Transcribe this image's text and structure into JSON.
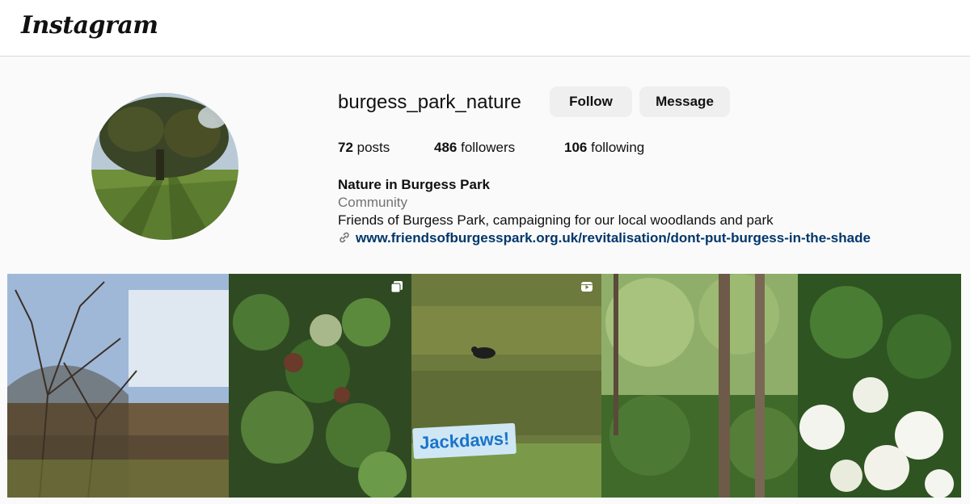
{
  "app": {
    "logo_text": "Instagram"
  },
  "profile": {
    "username": "burgess_park_nature",
    "follow_label": "Follow",
    "message_label": "Message",
    "stats": {
      "posts_count": "72",
      "posts_label": " posts",
      "followers_count": "486",
      "followers_label": " followers",
      "following_count": "106",
      "following_label": " following"
    },
    "bio": {
      "name": "Nature in Burgess Park",
      "category": "Community",
      "text": "Friends of Burgess Park, campaigning for our local woodlands and park",
      "link": "www.friendsofburgesspark.org.uk/revitalisation/dont-put-burgess-in-the-shade"
    }
  },
  "grid": {
    "posts": [
      {
        "alt": "bare-trees-and-hedge",
        "badge": ""
      },
      {
        "alt": "ivy-and-snowdrops",
        "badge": "carousel-icon"
      },
      {
        "alt": "jackdaw-on-grass",
        "badge": "reel-icon",
        "sticker": "Jackdaws!"
      },
      {
        "alt": "woodland-trees",
        "badge": ""
      },
      {
        "alt": "hawthorn-blossom",
        "badge": ""
      }
    ]
  },
  "colors": {
    "link": "#00376b",
    "button_bg": "#efefef",
    "muted_text": "#737373"
  }
}
